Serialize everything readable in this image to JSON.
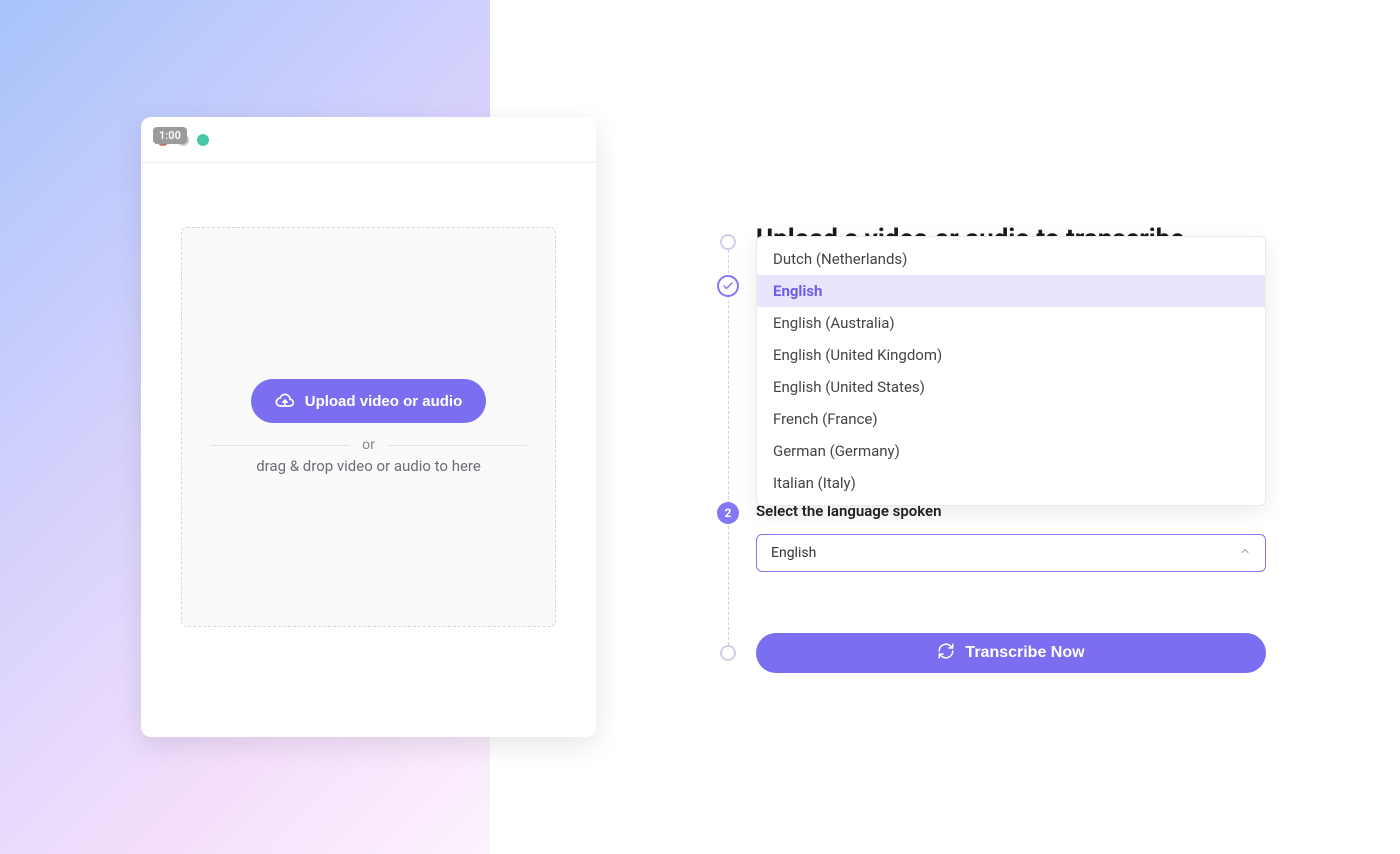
{
  "badge": "1:00",
  "upload": {
    "button_label": "Upload video or audio",
    "or": "or",
    "dragdrop": "drag & drop video or audio to here"
  },
  "steps": {
    "title": "Upload a video or audio to transcribe",
    "step2_number": "2",
    "step2_label": "Select the language spoken",
    "selected_language": "English"
  },
  "languages": [
    {
      "label": "Dutch (Netherlands)",
      "selected": false
    },
    {
      "label": "English",
      "selected": true
    },
    {
      "label": "English (Australia)",
      "selected": false
    },
    {
      "label": "English (United Kingdom)",
      "selected": false
    },
    {
      "label": "English (United States)",
      "selected": false
    },
    {
      "label": "French (France)",
      "selected": false
    },
    {
      "label": "German (Germany)",
      "selected": false
    },
    {
      "label": "Italian (Italy)",
      "selected": false
    }
  ],
  "transcribe_label": "Transcribe Now"
}
